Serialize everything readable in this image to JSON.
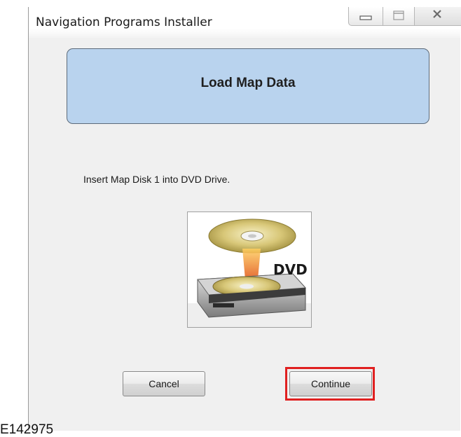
{
  "window": {
    "title": "Navigation Programs Installer"
  },
  "banner": {
    "title": "Load Map Data"
  },
  "instruction": "Insert Map Disk 1 into DVD Drive.",
  "dvd_image": {
    "label": "DVD"
  },
  "buttons": {
    "cancel": "Cancel",
    "continue": "Continue"
  },
  "figure_id": "E142975",
  "colors": {
    "banner_fill": "#b9d3ee",
    "highlight": "#e02020"
  }
}
